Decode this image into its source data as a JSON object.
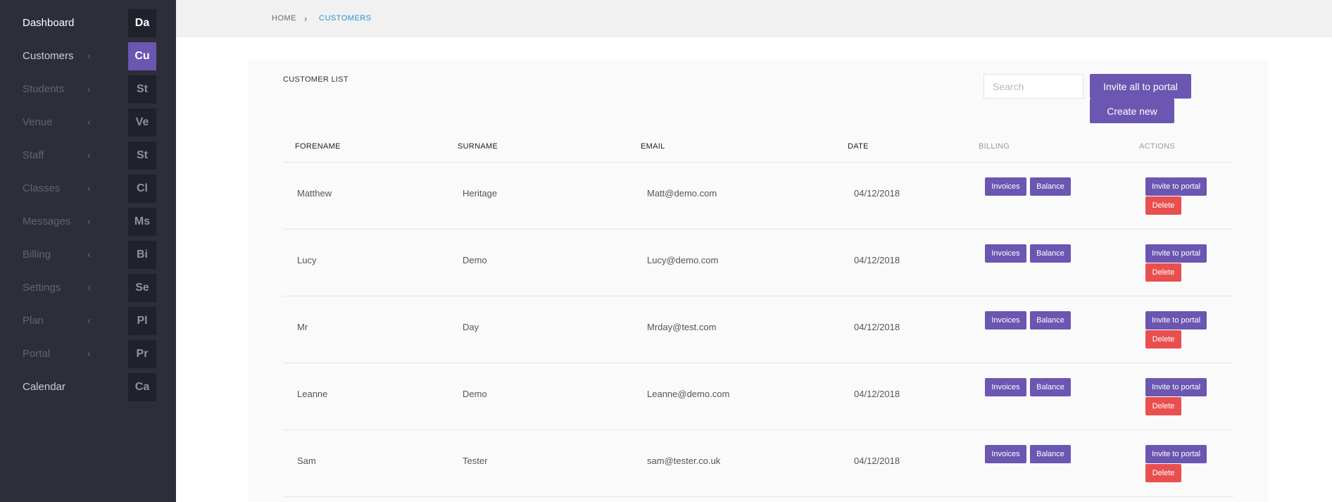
{
  "sidebar": {
    "items": [
      {
        "label": "Dashboard",
        "abbr": "Da",
        "chevron": ""
      },
      {
        "label": "Customers",
        "abbr": "Cu",
        "chevron": "‹"
      },
      {
        "label": "Students",
        "abbr": "St",
        "chevron": "‹"
      },
      {
        "label": "Venue",
        "abbr": "Ve",
        "chevron": "‹"
      },
      {
        "label": "Staff",
        "abbr": "St",
        "chevron": "‹"
      },
      {
        "label": "Classes",
        "abbr": "Cl",
        "chevron": "‹"
      },
      {
        "label": "Messages",
        "abbr": "Ms",
        "chevron": "‹"
      },
      {
        "label": "Billing",
        "abbr": "Bi",
        "chevron": "‹"
      },
      {
        "label": "Settings",
        "abbr": "Se",
        "chevron": "‹"
      },
      {
        "label": "Plan",
        "abbr": "Pl",
        "chevron": "‹"
      },
      {
        "label": "Portal",
        "abbr": "Pr",
        "chevron": "‹"
      },
      {
        "label": "Calendar",
        "abbr": "Ca",
        "chevron": ""
      }
    ]
  },
  "breadcrumb": {
    "home": "HOME",
    "separator": "›",
    "current": "CUSTOMERS"
  },
  "customer_list": {
    "title": "CUSTOMER LIST",
    "search_placeholder": "Search",
    "invite_all_label": "Invite all to portal",
    "create_new_label": "Create new",
    "columns": {
      "forename": "FORENAME",
      "surname": "SURNAME",
      "email": "EMAIL",
      "date": "DATE",
      "billing": "BILLING",
      "actions": "ACTIONS"
    },
    "buttons": {
      "invoices": "Invoices",
      "balance": "Balance",
      "invite": "Invite to portal",
      "delete": "Delete"
    },
    "rows": [
      {
        "forename": "Matthew",
        "surname": "Heritage",
        "email": "Matt@demo.com",
        "date": "04/12/2018"
      },
      {
        "forename": "Lucy",
        "surname": "Demo",
        "email": "Lucy@demo.com",
        "date": "04/12/2018"
      },
      {
        "forename": "Mr",
        "surname": "Day",
        "email": "Mrday@test.com",
        "date": "04/12/2018"
      },
      {
        "forename": "Leanne",
        "surname": "Demo",
        "email": "Leanne@demo.com",
        "date": "04/12/2018"
      },
      {
        "forename": "Sam",
        "surname": "Tester",
        "email": "sam@tester.co.uk",
        "date": "04/12/2018"
      }
    ]
  },
  "colors": {
    "sidebar_bg": "#2c2f3a",
    "accent": "#6b56b1",
    "danger": "#e8504f",
    "link": "#2f8fd1"
  }
}
